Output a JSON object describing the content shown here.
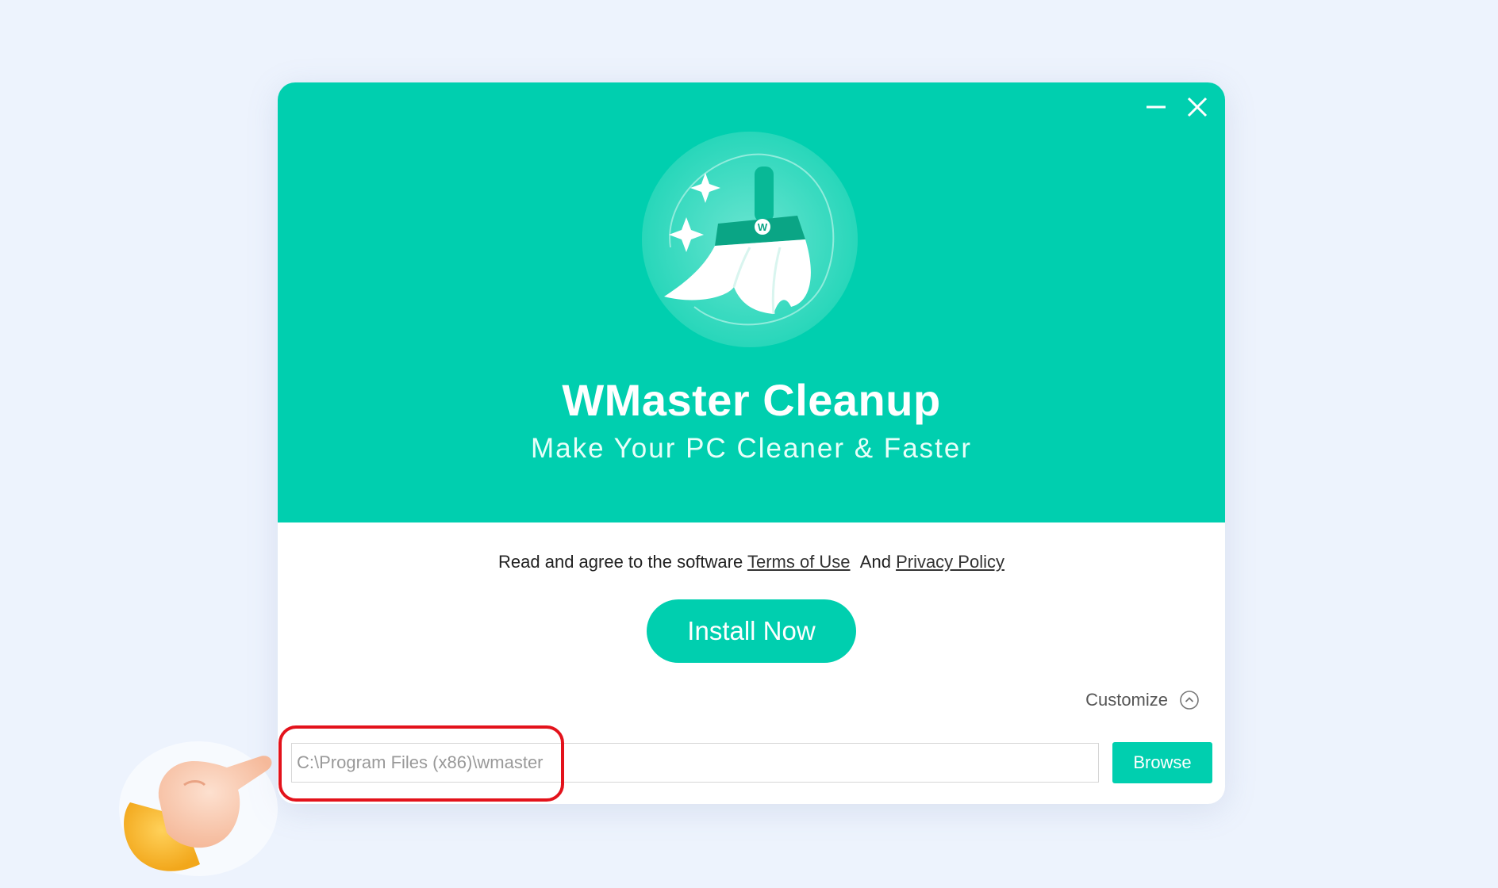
{
  "window": {
    "title": "WMaster Cleanup",
    "subtitle": "Make Your PC Cleaner & Faster",
    "logo_letter": "W"
  },
  "agreement": {
    "prefix": "Read and agree to the software",
    "terms_link": "Terms of Use",
    "and_text": "And",
    "privacy_link": "Privacy Policy"
  },
  "install_button": "Install Now",
  "customize_label": "Customize",
  "install_path": {
    "value": "C:\\Program Files (x86)\\wmaster"
  },
  "browse_button": "Browse",
  "colors": {
    "accent": "#00cfaf",
    "background": "#edf3fd",
    "highlight": "#e3121b"
  }
}
